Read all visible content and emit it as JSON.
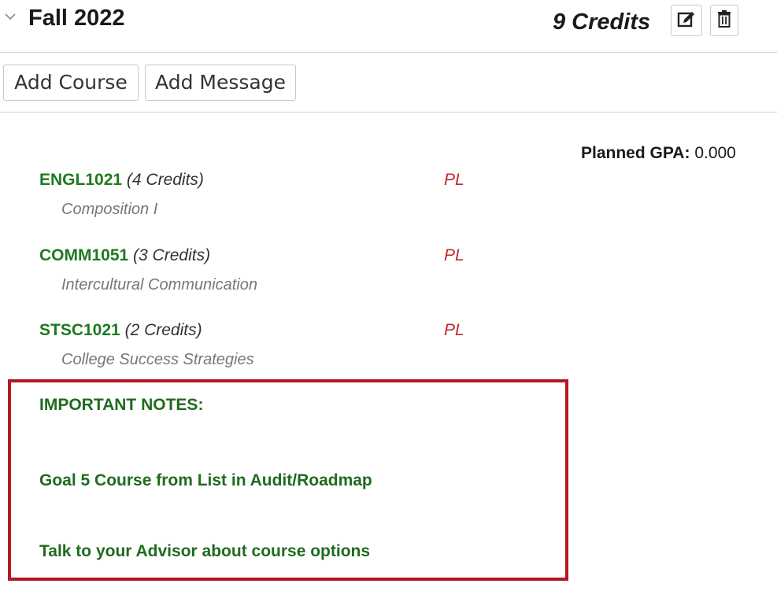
{
  "term": {
    "title": "Fall 2022",
    "credits": "9 Credits",
    "edit_icon": "edit-icon",
    "delete_icon": "trash-icon"
  },
  "actions": {
    "add_course": "Add Course",
    "add_message": "Add Message"
  },
  "gpa": {
    "label": "Planned GPA:",
    "value": "0.000"
  },
  "courses": [
    {
      "code": "ENGL1021",
      "credits": "(4 Credits)",
      "status": "PL",
      "title": "Composition I"
    },
    {
      "code": "COMM1051",
      "credits": "(3 Credits)",
      "status": "PL",
      "title": "Intercultural Communication"
    },
    {
      "code": "STSC1021",
      "credits": "(2 Credits)",
      "status": "PL",
      "title": "College Success Strategies"
    }
  ],
  "notes": {
    "heading": "IMPORTANT NOTES:",
    "lines": [
      "Goal 5 Course from List in Audit/Roadmap",
      "Talk to your Advisor about course options"
    ]
  },
  "colors": {
    "course_code": "#1f7a1f",
    "status": "#c0282d",
    "notes_border": "#b3181e"
  }
}
